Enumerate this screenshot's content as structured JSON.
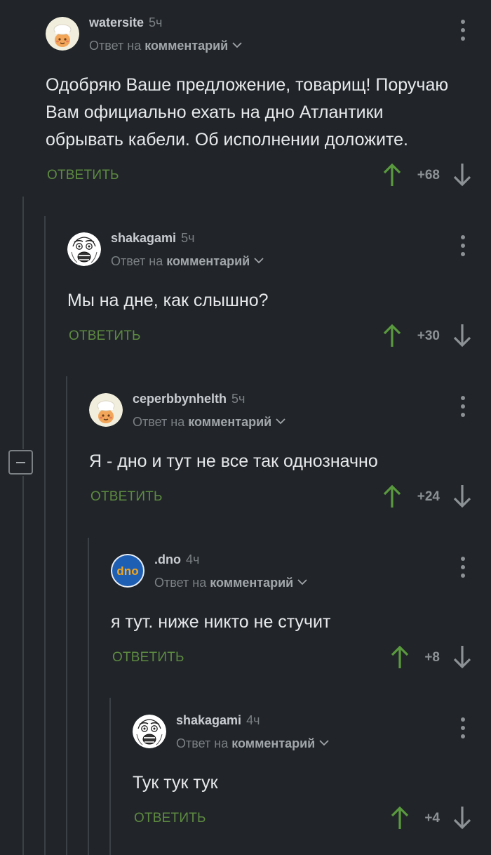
{
  "reply_prefix": "Ответ на",
  "reply_target": "комментарий",
  "reply_label": "ОТВЕТИТЬ",
  "colors": {
    "background": "#212529",
    "upvote_green": "#5a9a3e",
    "reply_green": "#5d8a41",
    "thread_line": "#3b4047"
  },
  "comments": [
    {
      "username": "watersite",
      "time": "5ч",
      "avatar": "chef-avatar-icon",
      "text": "Одобряю Ваше предложение, товарищ! Поручаю\nВам официально ехать на дно Атлантики\nобрывать кабели. Об исполнении доложите.",
      "score": "+68"
    },
    {
      "username": "shakagami",
      "time": "5ч",
      "avatar": "rage-face-avatar-icon",
      "text": "Мы на дне, как слышно?",
      "score": "+30"
    },
    {
      "username": "ceperbbynhelth",
      "time": "5ч",
      "avatar": "chef-avatar-icon",
      "text": "Я - дно и тут не все так однозначно",
      "score": "+24"
    },
    {
      "username": ".dno",
      "time": "4ч",
      "avatar": "dno-logo-avatar-icon",
      "avatar_text": "dno",
      "text": "я тут. ниже никто не стучит",
      "score": "+8"
    },
    {
      "username": "shakagami",
      "time": "4ч",
      "avatar": "rage-face-avatar-icon",
      "text": "Тук тук тук",
      "score": "+4"
    }
  ]
}
